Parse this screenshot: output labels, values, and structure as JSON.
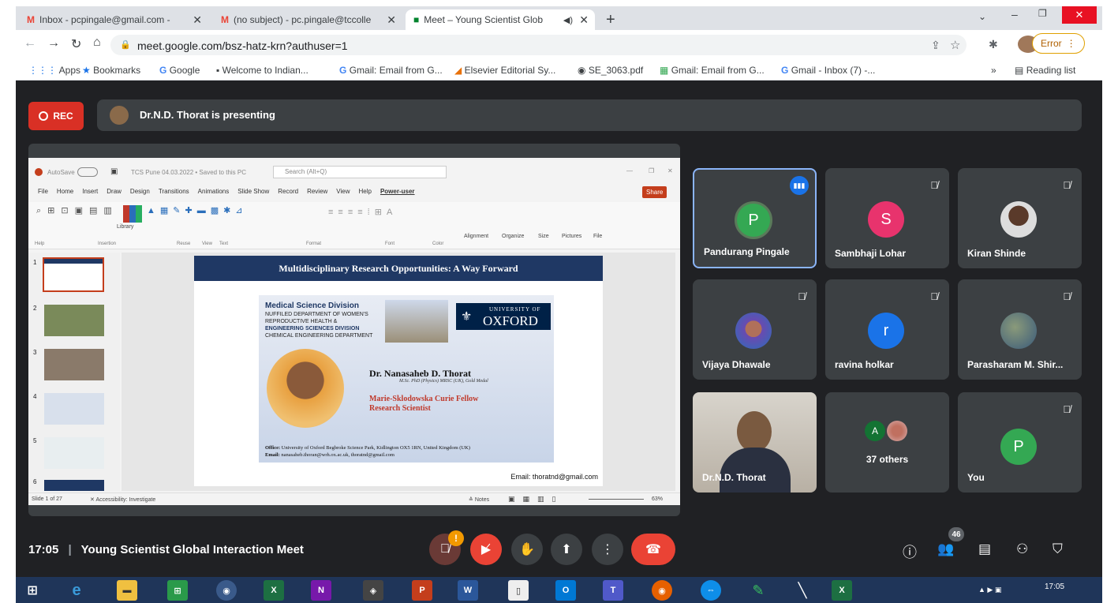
{
  "browser": {
    "tabs": [
      {
        "label": "Inbox - pcpingale@gmail.com -"
      },
      {
        "label": "(no subject) - pc.pingale@tccolle"
      },
      {
        "label": "Meet – Young Scientist Glob"
      }
    ],
    "new_tab": "+",
    "url": "meet.google.com/bsz-hatz-krn?authuser=1",
    "error_label": "Error",
    "bookmarks": [
      "Apps",
      "Bookmarks",
      "Google",
      "Welcome to Indian...",
      "Gmail: Email from G...",
      "Elsevier Editorial Sy...",
      "SE_3063.pdf",
      "Gmail: Email from G...",
      "Gmail - Inbox (7) -..."
    ],
    "reading_list": "Reading list"
  },
  "meet": {
    "rec_label": "REC",
    "presenting_text": "Dr.N.D. Thorat is presenting",
    "time": "17:05",
    "meeting_title": "Young Scientist Global Interaction Meet",
    "participants_count": "46",
    "tiles": [
      {
        "name": "Pandurang Pingale",
        "initial": "P",
        "color": "#34a853"
      },
      {
        "name": "Sambhaji Lohar",
        "initial": "S",
        "color": "#e8336d"
      },
      {
        "name": "Kiran Shinde",
        "initial": ""
      },
      {
        "name": "Vijaya Dhawale",
        "initial": ""
      },
      {
        "name": "ravina holkar",
        "initial": "r",
        "color": "#1a73e8"
      },
      {
        "name": "Parasharam M. Shir...",
        "initial": ""
      },
      {
        "name": "Dr.N.D. Thorat",
        "initial": ""
      },
      {
        "name": "37 others",
        "initial": "A",
        "color": "#137333"
      },
      {
        "name": "You",
        "initial": "P",
        "color": "#34a853"
      }
    ]
  },
  "ppt": {
    "title_bar": "TCS Pune 04.03.2022 • Saved to this PC",
    "search": "Search (Alt+Q)",
    "autosave": "AutoSave",
    "share": "Share",
    "menu": [
      "File",
      "Home",
      "Insert",
      "Draw",
      "Design",
      "Transitions",
      "Animations",
      "Slide Show",
      "Record",
      "Review",
      "View",
      "Help",
      "Power-user"
    ],
    "ribbon_groups": [
      "Help",
      "Insertion",
      "Reuse",
      "View",
      "Text",
      "Format",
      "Font",
      "Color"
    ],
    "ribbon_tools": [
      "Library",
      "Alignment",
      "Organize",
      "Size",
      "Pictures",
      "File"
    ],
    "status_left": "Slide 1 of 27",
    "accessibility": "Accessibility: Investigate",
    "notes": "Notes",
    "zoom": "63%",
    "slide_numbers": [
      "1",
      "2",
      "3",
      "4",
      "5",
      "6"
    ],
    "slide": {
      "title": "Multidisciplinary Research Opportunities: A Way Forward",
      "division": "Medical Science Division",
      "dept1": "NUFFILED DEPARTMENT OF WOMEN'S",
      "dept2": "REPRODUCTIVE HEALTH &",
      "division2": "ENGINEERING SCIENCES DIVISION",
      "dept3": "CHEMICAL ENGINEERING DEPARTMENT",
      "uni_small": "UNIVERSITY OF",
      "uni_big": "OXFORD",
      "name": "Dr. Nanasaheb D. Thorat",
      "quals": "M.Sc. PhD (Physics) MRSC (UK), Gold Medal",
      "fellow1": "Marie-Sklodowska Curie Fellow",
      "fellow2": "Research Scientist",
      "office_label": "Office:",
      "office": "University of Oxford Begbroke Science Park, Kidlington OX5 1RN, United Kingdom (UK)",
      "email_label": "Email:",
      "email": "nanasaheb.thoran@wrh.ox.ac.uk, thoratnd@gmail.com",
      "footer_email": "Email: thoratnd@gmail.com"
    }
  },
  "taskbar": {
    "clock": "17:05"
  },
  "colors": {
    "meet_bg": "#202124",
    "tile": "#3c4043",
    "rec": "#d93025",
    "active_border": "#8ab4f8",
    "end_call": "#ea4335"
  }
}
